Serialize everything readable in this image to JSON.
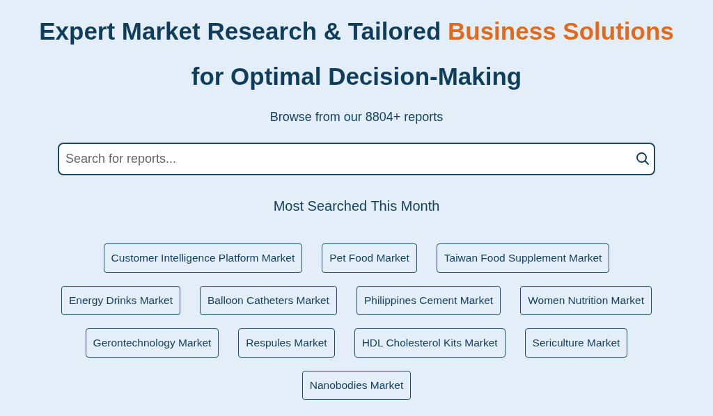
{
  "heading": {
    "text": "Expert Market Research & Tailored",
    "highlight": "Business Solutions",
    "line_2": "for Optimal Decision-Making"
  },
  "subtitle": "Browse from our 8804+ reports",
  "search": {
    "placeholder": "Search for reports..."
  },
  "section_title": "Most Searched This Month",
  "tag_rows": [
    [
      "Customer Intelligence Platform Market",
      "Pet Food Market",
      "Taiwan Food Supplement Market"
    ],
    [
      "Energy Drinks Market",
      "Balloon Catheters Market",
      "Philippines Cement Market",
      "Women Nutrition Market"
    ],
    [
      "Gerontechnology Market",
      "Respules Market",
      "HDL Cholesterol Kits Market",
      "Sericulture Market"
    ],
    [
      "Nanobodies Market"
    ]
  ]
}
